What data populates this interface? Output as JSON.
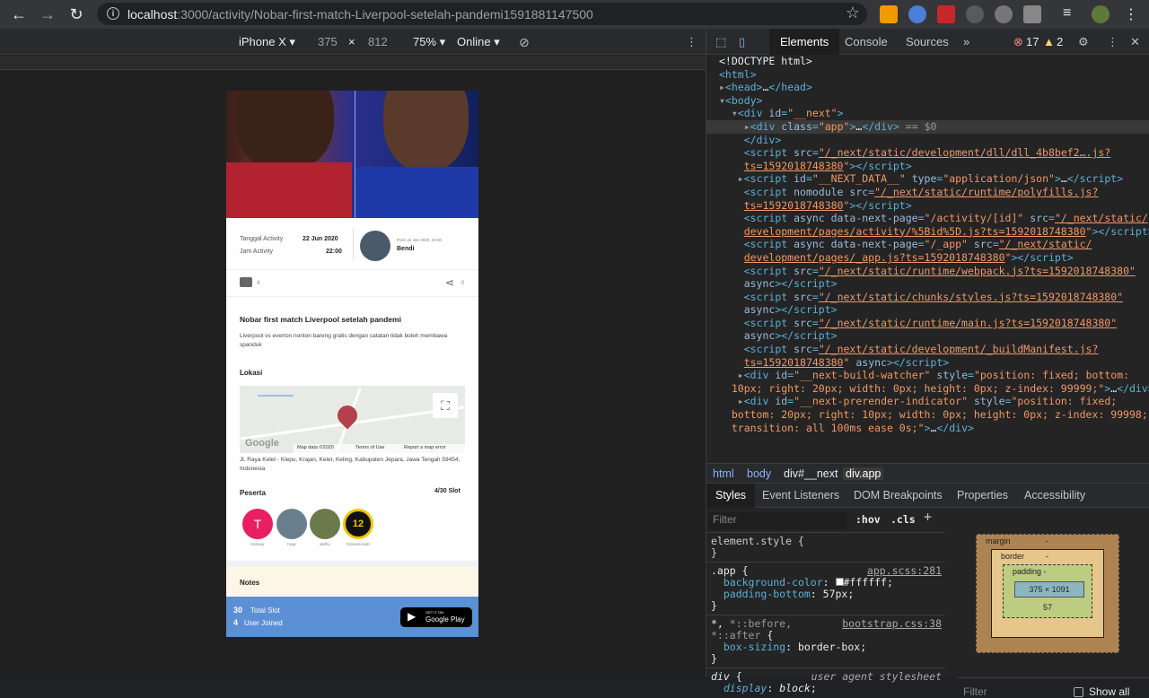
{
  "browser": {
    "url_host": "localhost",
    "url_path": ":3000/activity/Nobar-first-match-Liverpool-setelah-pandemi1591881147500"
  },
  "devtools_toolbar": {
    "device": "iPhone X ▾",
    "width": "375",
    "x": "×",
    "height": "812",
    "zoom": "75% ▾",
    "network": "Online ▾"
  },
  "app": {
    "tanggal_label": "Tanggal Activity",
    "tanggal_value": "22 Jun 2020",
    "jam_label": "Jam Activity",
    "jam_value": "22:00",
    "post_meta": "Post: 22 Jun 2020, 22:00",
    "post_author": "Bendi",
    "comments_count": "4",
    "shares_count": "0",
    "title": "Nobar first match Liverpool setelah pandemi",
    "description": "Liverpool vs everton nonton bareng gratis dengan catatan tidak boleh membawa spanduk",
    "lokasi_label": "Lokasi",
    "map_data": "Map data ©2020",
    "map_terms": "Terms of Use",
    "map_report": "Report a map error",
    "map_google": "Google",
    "address": "Jl. Raya Kelet - Klepu, Krajan, Kelet, Keling, Kabupaten Jepara, Jawa Tengah 59454, Indonesia",
    "peserta_label": "Peserta",
    "slot": "4/30 Slot",
    "participants": [
      {
        "initial": "T",
        "name": "trahanjr"
      },
      {
        "initial": "",
        "name": "hyap"
      },
      {
        "initial": "",
        "name": "alidho"
      },
      {
        "initial": "12",
        "name": "bramanvisab"
      }
    ],
    "notes_label": "Notes",
    "total_slot_num": "30",
    "total_slot_label": "Total Slot",
    "joined_num": "4",
    "joined_label": "User Joined",
    "google_play_small": "GET IT ON",
    "google_play": "Google Play"
  },
  "devtools": {
    "tabs": [
      "Elements",
      "Console",
      "Sources",
      "»"
    ],
    "errors": "17",
    "warnings": "2",
    "crumbs": [
      "html",
      "body",
      "div#__next",
      "div.app"
    ],
    "sub_tabs": [
      "Styles",
      "Event Listeners",
      "DOM Breakpoints",
      "Properties",
      "Accessibility"
    ],
    "filter_placeholder": "Filter",
    "hov": ":hov",
    ".cls": ".cls",
    "box": {
      "margin": "margin",
      "margin_val": "-",
      "border": "border",
      "border_val": "-",
      "padding": "padding -",
      "content": "375 × 1091",
      "padding_bottom": "57",
      "dash": "-"
    },
    "box_filter": "Filter",
    "show_all": "Show all"
  }
}
